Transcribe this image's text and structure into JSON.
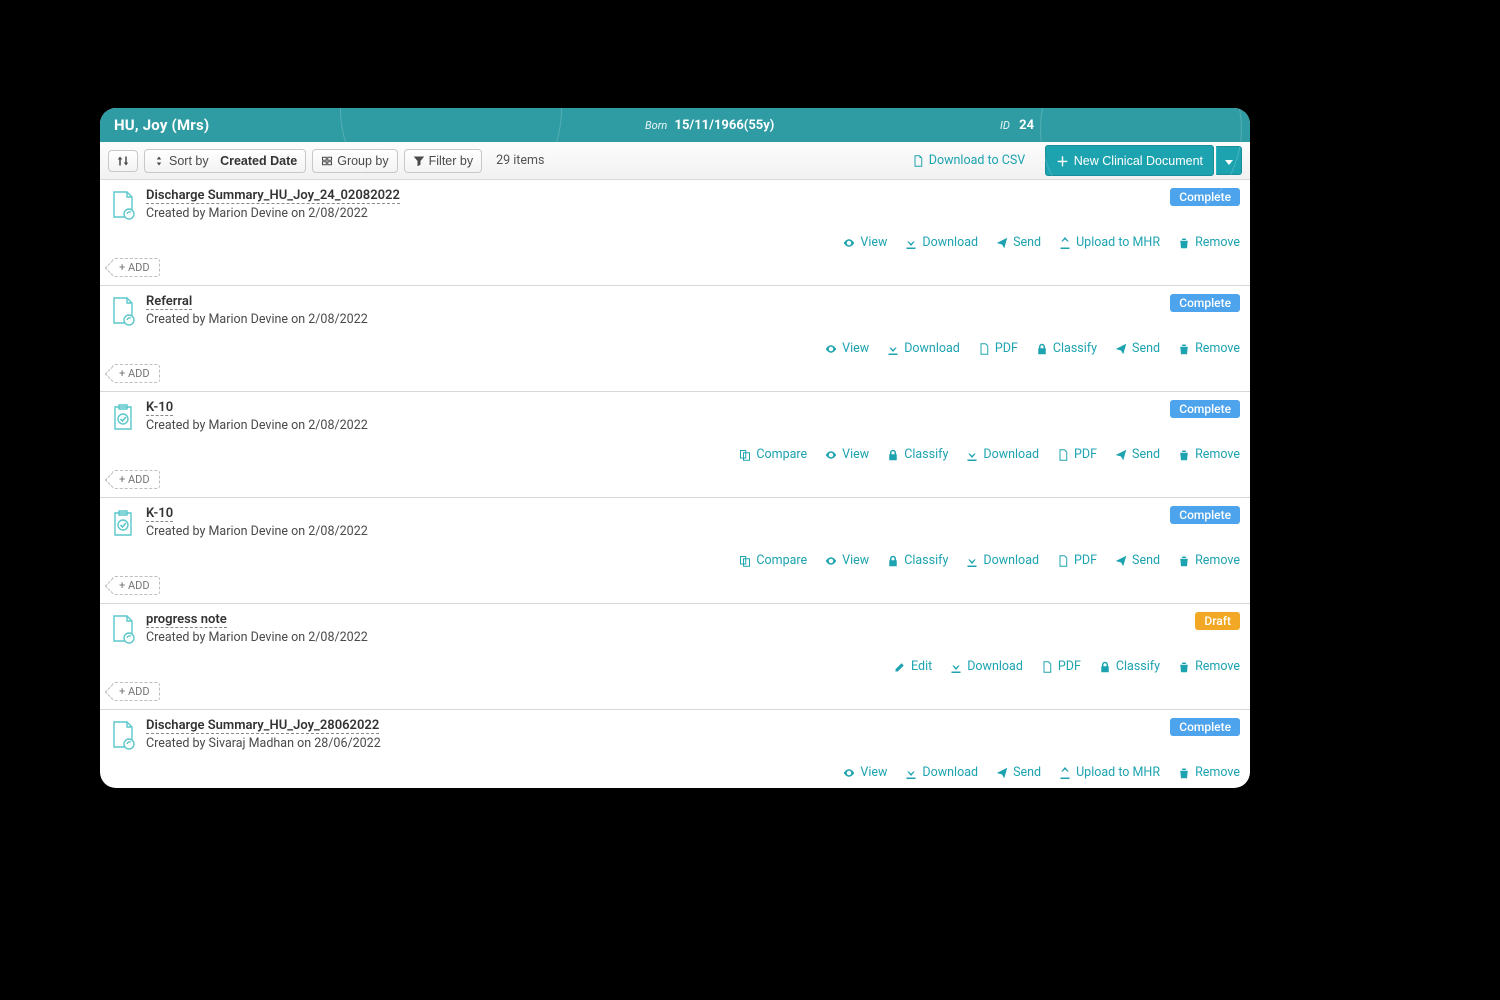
{
  "patient": {
    "name": "HU, Joy (Mrs)",
    "born_label": "Born",
    "born_value": "15/11/1966(55y)",
    "id_label": "ID",
    "id_value": "24"
  },
  "toolbar": {
    "sort_prefix": "Sort by",
    "sort_field": "Created Date",
    "group_by": "Group by",
    "filter_by": "Filter by",
    "count": "29 items",
    "download_csv": "Download to CSV",
    "new_doc": "New Clinical Document"
  },
  "badges": {
    "complete": "Complete",
    "draft": "Draft"
  },
  "actions": {
    "view": "View",
    "download": "Download",
    "send": "Send",
    "upload_mhr": "Upload to MHR",
    "remove": "Remove",
    "pdf": "PDF",
    "classify": "Classify",
    "compare": "Compare",
    "edit": "Edit",
    "add": "+ ADD"
  },
  "rows": [
    {
      "title": "Discharge Summary_HU_Joy_24_02082022",
      "sub": "Created by Marion Devine on 2/08/2022",
      "status": "complete",
      "icon": "doc",
      "actions": [
        "view",
        "download",
        "send",
        "upload_mhr",
        "remove"
      ]
    },
    {
      "title": "Referral",
      "sub": "Created by Marion Devine on 2/08/2022",
      "status": "complete",
      "icon": "doc",
      "actions": [
        "view",
        "download",
        "pdf",
        "classify",
        "send",
        "remove"
      ]
    },
    {
      "title": "K-10",
      "sub": "Created by Marion Devine on 2/08/2022",
      "status": "complete",
      "icon": "clip",
      "actions": [
        "compare",
        "view",
        "classify",
        "download",
        "pdf",
        "send",
        "remove"
      ]
    },
    {
      "title": "K-10",
      "sub": "Created by Marion Devine on 2/08/2022",
      "status": "complete",
      "icon": "clip",
      "actions": [
        "compare",
        "view",
        "classify",
        "download",
        "pdf",
        "send",
        "remove"
      ]
    },
    {
      "title": "progress note",
      "sub": "Created by Marion Devine on 2/08/2022",
      "status": "draft",
      "icon": "doc",
      "actions": [
        "edit",
        "download",
        "pdf",
        "classify",
        "remove"
      ]
    },
    {
      "title": "Discharge Summary_HU_Joy_28062022",
      "sub": "Created by Sivaraj Madhan on 28/06/2022",
      "status": "complete",
      "icon": "doc",
      "actions": [
        "view",
        "download",
        "send",
        "upload_mhr",
        "remove"
      ]
    }
  ]
}
